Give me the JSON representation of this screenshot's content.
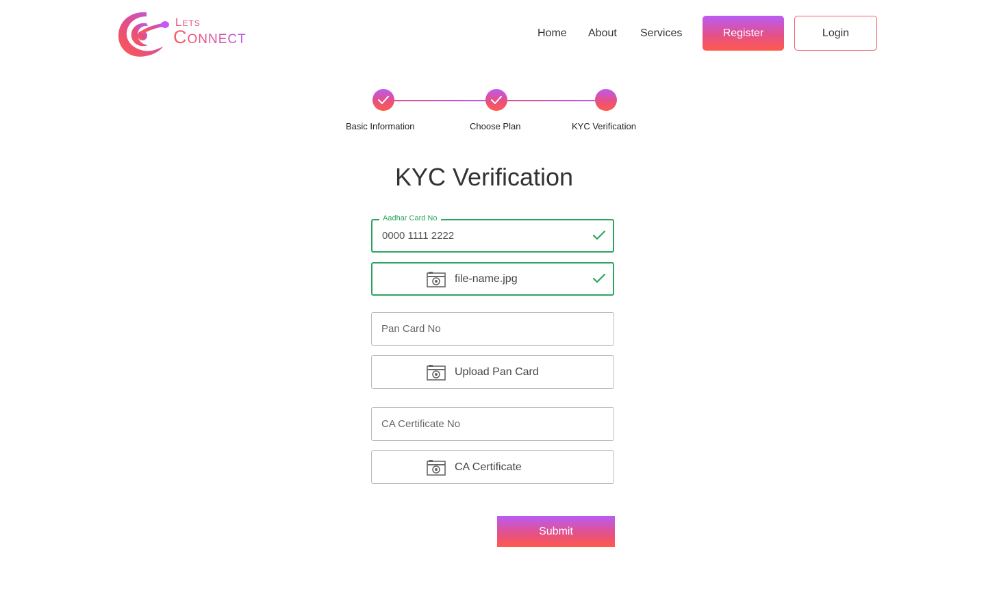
{
  "brand": {
    "line1": "Lets",
    "line2": "Connect"
  },
  "nav": {
    "items": [
      "Home",
      "About",
      "Services"
    ],
    "register_label": "Register",
    "login_label": "Login"
  },
  "stepper": {
    "steps": [
      {
        "label": "Basic Information",
        "state": "completed"
      },
      {
        "label": "Choose Plan",
        "state": "completed"
      },
      {
        "label": "KYC Verification",
        "state": "current"
      }
    ]
  },
  "page": {
    "title": "KYC Verification"
  },
  "form": {
    "aadhar": {
      "label": "Aadhar Card No",
      "value": "0000 1111 2222",
      "status": "valid",
      "file_name": "file-name.jpg"
    },
    "pan": {
      "placeholder": "Pan Card No",
      "value": "",
      "upload_label": "Upload Pan Card"
    },
    "ca": {
      "placeholder": "CA Certificate No",
      "value": "",
      "upload_label": "CA Certificate"
    },
    "submit_label": "Submit"
  },
  "colors": {
    "accent_start": "#ff5a4a",
    "accent_end": "#b95cf6",
    "valid": "#2ba55d",
    "border": "#b9b9b9"
  },
  "icons": {
    "upload": "camera-icon",
    "valid": "check-icon",
    "step_done": "checkmark-icon"
  }
}
